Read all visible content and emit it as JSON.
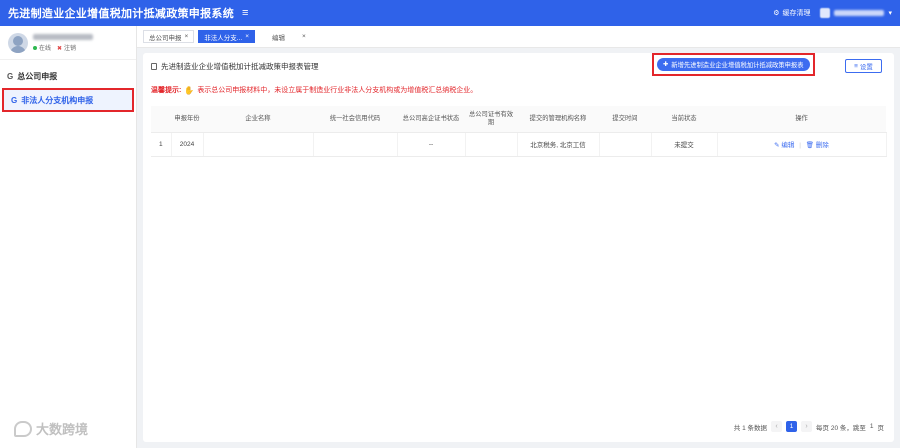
{
  "header": {
    "title": "先进制造业企业增值税加计抵减政策申报系统",
    "cache_label": "缓存清理"
  },
  "profile": {
    "status_online": "在线",
    "logout_label": "注销"
  },
  "sidebar": {
    "items": [
      {
        "label": "总公司申报"
      },
      {
        "label": "非法人分支机构申报"
      }
    ]
  },
  "tabs": [
    {
      "label": "总公司申报"
    },
    {
      "label": "非法人分支..."
    },
    {
      "label": "编辑"
    }
  ],
  "main": {
    "panel_title": "先进制造业企业增值税加计抵减政策申报表管理",
    "new_button": "新增先进制造业企业增值税加计抵减政策申报表",
    "settings_button": "设置",
    "notice_label": "温馨提示:",
    "notice_text": "表示总公司申报材料中，未设立属于制造业行业非法人分支机构或为增值税汇总纳税企业。"
  },
  "table": {
    "headers": [
      "",
      "申报年份",
      "企业名称",
      "统一社会信用代码",
      "总公司高企证书状态",
      "总公司证书有效期",
      "提交的管理机构名称",
      "提交时间",
      "当前状态",
      "操作"
    ],
    "rows": [
      {
        "index": "1",
        "year": "2024",
        "name": "",
        "code": "",
        "cert_status": "--",
        "cert_valid": "",
        "org": "北京税务, 北京工信",
        "time": "",
        "status": "未提交",
        "edit": "编辑",
        "delete": "删除"
      }
    ]
  },
  "pager": {
    "total": "共 1 条数据",
    "current": "1",
    "page_size": "每页 20 条，跳至",
    "goto": "1",
    "page_unit": "页"
  },
  "watermark": {
    "text": "大数跨境"
  },
  "colors": {
    "primary": "#2f62e9",
    "highlight": "#e3262b",
    "notice": "#e3262b"
  }
}
